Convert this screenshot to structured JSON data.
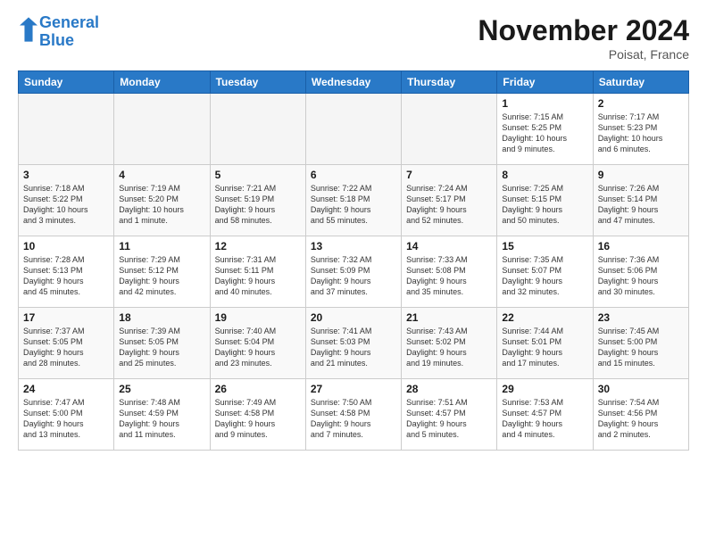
{
  "header": {
    "logo_line1": "General",
    "logo_line2": "Blue",
    "month": "November 2024",
    "location": "Poisat, France"
  },
  "weekdays": [
    "Sunday",
    "Monday",
    "Tuesday",
    "Wednesday",
    "Thursday",
    "Friday",
    "Saturday"
  ],
  "weeks": [
    [
      {
        "day": "",
        "info": ""
      },
      {
        "day": "",
        "info": ""
      },
      {
        "day": "",
        "info": ""
      },
      {
        "day": "",
        "info": ""
      },
      {
        "day": "",
        "info": ""
      },
      {
        "day": "1",
        "info": "Sunrise: 7:15 AM\nSunset: 5:25 PM\nDaylight: 10 hours\nand 9 minutes."
      },
      {
        "day": "2",
        "info": "Sunrise: 7:17 AM\nSunset: 5:23 PM\nDaylight: 10 hours\nand 6 minutes."
      }
    ],
    [
      {
        "day": "3",
        "info": "Sunrise: 7:18 AM\nSunset: 5:22 PM\nDaylight: 10 hours\nand 3 minutes."
      },
      {
        "day": "4",
        "info": "Sunrise: 7:19 AM\nSunset: 5:20 PM\nDaylight: 10 hours\nand 1 minute."
      },
      {
        "day": "5",
        "info": "Sunrise: 7:21 AM\nSunset: 5:19 PM\nDaylight: 9 hours\nand 58 minutes."
      },
      {
        "day": "6",
        "info": "Sunrise: 7:22 AM\nSunset: 5:18 PM\nDaylight: 9 hours\nand 55 minutes."
      },
      {
        "day": "7",
        "info": "Sunrise: 7:24 AM\nSunset: 5:17 PM\nDaylight: 9 hours\nand 52 minutes."
      },
      {
        "day": "8",
        "info": "Sunrise: 7:25 AM\nSunset: 5:15 PM\nDaylight: 9 hours\nand 50 minutes."
      },
      {
        "day": "9",
        "info": "Sunrise: 7:26 AM\nSunset: 5:14 PM\nDaylight: 9 hours\nand 47 minutes."
      }
    ],
    [
      {
        "day": "10",
        "info": "Sunrise: 7:28 AM\nSunset: 5:13 PM\nDaylight: 9 hours\nand 45 minutes."
      },
      {
        "day": "11",
        "info": "Sunrise: 7:29 AM\nSunset: 5:12 PM\nDaylight: 9 hours\nand 42 minutes."
      },
      {
        "day": "12",
        "info": "Sunrise: 7:31 AM\nSunset: 5:11 PM\nDaylight: 9 hours\nand 40 minutes."
      },
      {
        "day": "13",
        "info": "Sunrise: 7:32 AM\nSunset: 5:09 PM\nDaylight: 9 hours\nand 37 minutes."
      },
      {
        "day": "14",
        "info": "Sunrise: 7:33 AM\nSunset: 5:08 PM\nDaylight: 9 hours\nand 35 minutes."
      },
      {
        "day": "15",
        "info": "Sunrise: 7:35 AM\nSunset: 5:07 PM\nDaylight: 9 hours\nand 32 minutes."
      },
      {
        "day": "16",
        "info": "Sunrise: 7:36 AM\nSunset: 5:06 PM\nDaylight: 9 hours\nand 30 minutes."
      }
    ],
    [
      {
        "day": "17",
        "info": "Sunrise: 7:37 AM\nSunset: 5:05 PM\nDaylight: 9 hours\nand 28 minutes."
      },
      {
        "day": "18",
        "info": "Sunrise: 7:39 AM\nSunset: 5:05 PM\nDaylight: 9 hours\nand 25 minutes."
      },
      {
        "day": "19",
        "info": "Sunrise: 7:40 AM\nSunset: 5:04 PM\nDaylight: 9 hours\nand 23 minutes."
      },
      {
        "day": "20",
        "info": "Sunrise: 7:41 AM\nSunset: 5:03 PM\nDaylight: 9 hours\nand 21 minutes."
      },
      {
        "day": "21",
        "info": "Sunrise: 7:43 AM\nSunset: 5:02 PM\nDaylight: 9 hours\nand 19 minutes."
      },
      {
        "day": "22",
        "info": "Sunrise: 7:44 AM\nSunset: 5:01 PM\nDaylight: 9 hours\nand 17 minutes."
      },
      {
        "day": "23",
        "info": "Sunrise: 7:45 AM\nSunset: 5:00 PM\nDaylight: 9 hours\nand 15 minutes."
      }
    ],
    [
      {
        "day": "24",
        "info": "Sunrise: 7:47 AM\nSunset: 5:00 PM\nDaylight: 9 hours\nand 13 minutes."
      },
      {
        "day": "25",
        "info": "Sunrise: 7:48 AM\nSunset: 4:59 PM\nDaylight: 9 hours\nand 11 minutes."
      },
      {
        "day": "26",
        "info": "Sunrise: 7:49 AM\nSunset: 4:58 PM\nDaylight: 9 hours\nand 9 minutes."
      },
      {
        "day": "27",
        "info": "Sunrise: 7:50 AM\nSunset: 4:58 PM\nDaylight: 9 hours\nand 7 minutes."
      },
      {
        "day": "28",
        "info": "Sunrise: 7:51 AM\nSunset: 4:57 PM\nDaylight: 9 hours\nand 5 minutes."
      },
      {
        "day": "29",
        "info": "Sunrise: 7:53 AM\nSunset: 4:57 PM\nDaylight: 9 hours\nand 4 minutes."
      },
      {
        "day": "30",
        "info": "Sunrise: 7:54 AM\nSunset: 4:56 PM\nDaylight: 9 hours\nand 2 minutes."
      }
    ]
  ]
}
